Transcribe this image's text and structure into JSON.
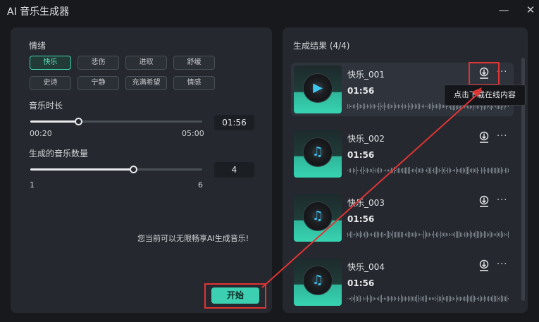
{
  "window": {
    "title": "AI 音乐生成器",
    "minimize_icon": "—",
    "close_icon": "✕"
  },
  "left": {
    "mood_label": "情绪",
    "moods": [
      "快乐",
      "悲伤",
      "进取",
      "舒缓",
      "史诗",
      "宁静",
      "充满希望",
      "情感"
    ],
    "selected_mood": "快乐",
    "duration": {
      "label": "音乐时长",
      "min": "00:20",
      "max": "05:00",
      "value": "01:56",
      "fraction": 0.28
    },
    "count": {
      "label": "生成的音乐数量",
      "min": "1",
      "max": "6",
      "value": "4",
      "fraction": 0.6
    },
    "notice": "您当前可以无限畅享AI生成音乐!",
    "start_label": "开始"
  },
  "right": {
    "results_title": "生成结果 (4/4)",
    "items": [
      {
        "name": "快乐_001",
        "duration": "01:56"
      },
      {
        "name": "快乐_002",
        "duration": "01:56"
      },
      {
        "name": "快乐_003",
        "duration": "01:56"
      },
      {
        "name": "快乐_004",
        "duration": "01:56"
      }
    ],
    "tooltip": "点击下载在线内容",
    "more_icon": "···"
  },
  "colors": {
    "accent": "#3ccfb1",
    "annotation": "#e03434",
    "panel": "#25292f",
    "background": "#17191d"
  }
}
